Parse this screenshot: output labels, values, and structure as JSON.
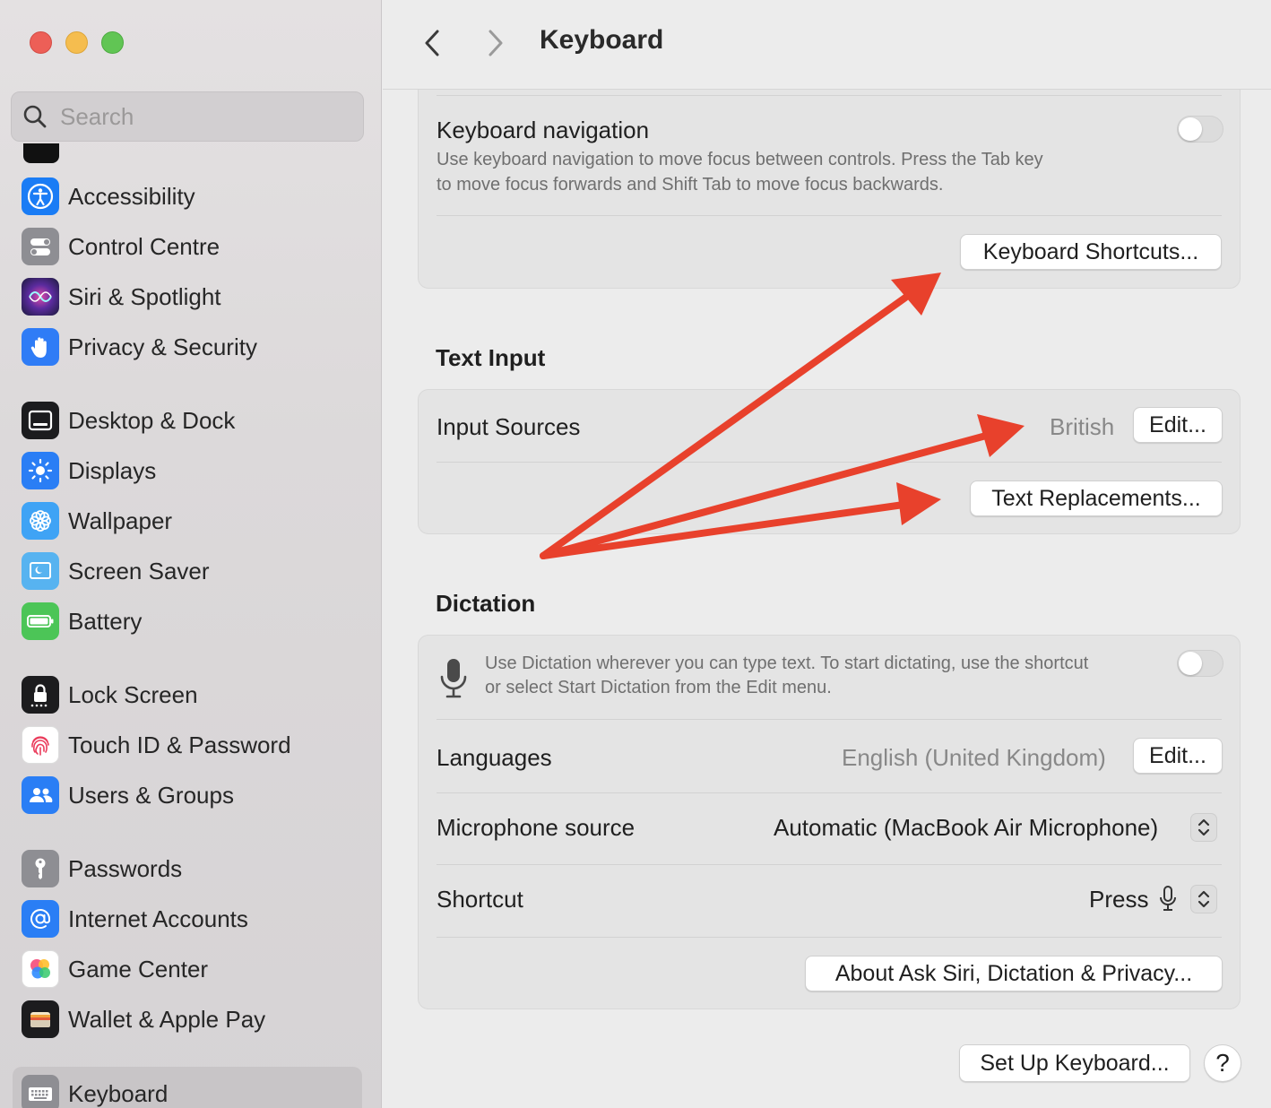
{
  "sidebar": {
    "search_placeholder": "Search",
    "groups": [
      [
        {
          "label": "Accessibility",
          "icon": "accessibility-icon",
          "color": "#1a7cf5"
        },
        {
          "label": "Control Centre",
          "icon": "control-centre-icon",
          "color": "#8e8e93"
        },
        {
          "label": "Siri & Spotlight",
          "icon": "siri-icon",
          "color": "#5b2b9e"
        },
        {
          "label": "Privacy & Security",
          "icon": "hand-icon",
          "color": "#2f7cf6"
        }
      ],
      [
        {
          "label": "Desktop & Dock",
          "icon": "desktop-dock-icon",
          "color": "#1c1c1e"
        },
        {
          "label": "Displays",
          "icon": "displays-icon",
          "color": "#2a7ef5"
        },
        {
          "label": "Wallpaper",
          "icon": "wallpaper-icon",
          "color": "#3fa3f5"
        },
        {
          "label": "Screen Saver",
          "icon": "screen-saver-icon",
          "color": "#57b3f0"
        },
        {
          "label": "Battery",
          "icon": "battery-icon",
          "color": "#4cc557"
        }
      ],
      [
        {
          "label": "Lock Screen",
          "icon": "lock-icon",
          "color": "#1c1c1e"
        },
        {
          "label": "Touch ID & Password",
          "icon": "fingerprint-icon",
          "color": "#ffffff"
        },
        {
          "label": "Users & Groups",
          "icon": "users-icon",
          "color": "#2a7ef5"
        }
      ],
      [
        {
          "label": "Passwords",
          "icon": "key-icon",
          "color": "#8e8e93"
        },
        {
          "label": "Internet Accounts",
          "icon": "at-icon",
          "color": "#2a7ef5"
        },
        {
          "label": "Game Center",
          "icon": "game-center-icon",
          "color": "#ffffff"
        },
        {
          "label": "Wallet & Apple Pay",
          "icon": "wallet-icon",
          "color": "#1c1c1e"
        }
      ]
    ],
    "active_item": {
      "label": "Keyboard",
      "icon": "keyboard-icon",
      "color": "#8e8e93"
    }
  },
  "header": {
    "title": "Keyboard"
  },
  "keyboard_nav": {
    "label": "Keyboard navigation",
    "description_line1": "Use keyboard navigation to move focus between controls. Press the Tab key",
    "description_line2": "to move focus forwards and Shift Tab to move focus backwards.",
    "enabled": false,
    "shortcuts_button": "Keyboard Shortcuts..."
  },
  "text_input": {
    "section_title": "Text Input",
    "input_sources_label": "Input Sources",
    "input_sources_value": "British",
    "edit_button": "Edit...",
    "text_replacements_button": "Text Replacements..."
  },
  "dictation": {
    "section_title": "Dictation",
    "description_line1": "Use Dictation wherever you can type text. To start dictating, use the shortcut",
    "description_line2": "or select Start Dictation from the Edit menu.",
    "enabled": false,
    "languages_label": "Languages",
    "languages_value": "English (United Kingdom)",
    "languages_edit": "Edit...",
    "mic_label": "Microphone source",
    "mic_value": "Automatic (MacBook Air Microphone)",
    "shortcut_label": "Shortcut",
    "shortcut_value": "Press",
    "about_button": "About Ask Siri, Dictation & Privacy..."
  },
  "footer": {
    "setup_button": "Set Up Keyboard...",
    "help_button": "?"
  },
  "annotation_color": "#e8412c"
}
